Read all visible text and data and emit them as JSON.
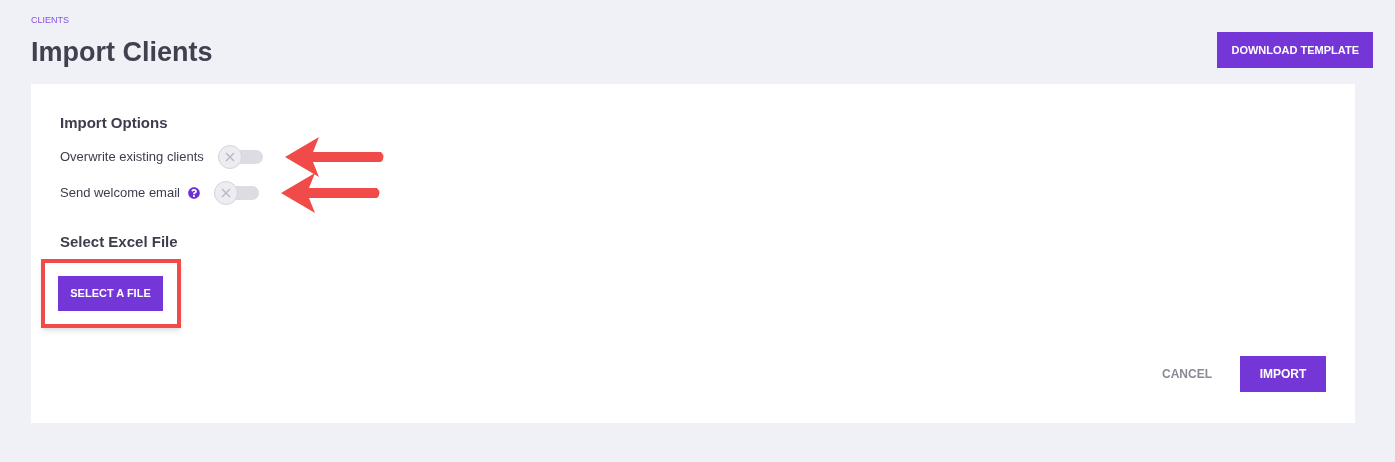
{
  "breadcrumb": "CLIENTS",
  "title": "Import Clients",
  "header_button": "DOWNLOAD TEMPLATE",
  "import_options": {
    "heading": "Import Options",
    "options": [
      {
        "label": "Overwrite existing clients",
        "on": false,
        "help": false,
        "annotated": true
      },
      {
        "label": "Send welcome email",
        "on": false,
        "help": true,
        "annotated": true
      }
    ]
  },
  "file_section": {
    "heading": "Select Excel File",
    "button": "SELECT A FILE",
    "highlighted": true
  },
  "footer_buttons": [
    {
      "label": "CANCEL",
      "kind": "text"
    },
    {
      "label": "IMPORT",
      "kind": "primary"
    }
  ]
}
